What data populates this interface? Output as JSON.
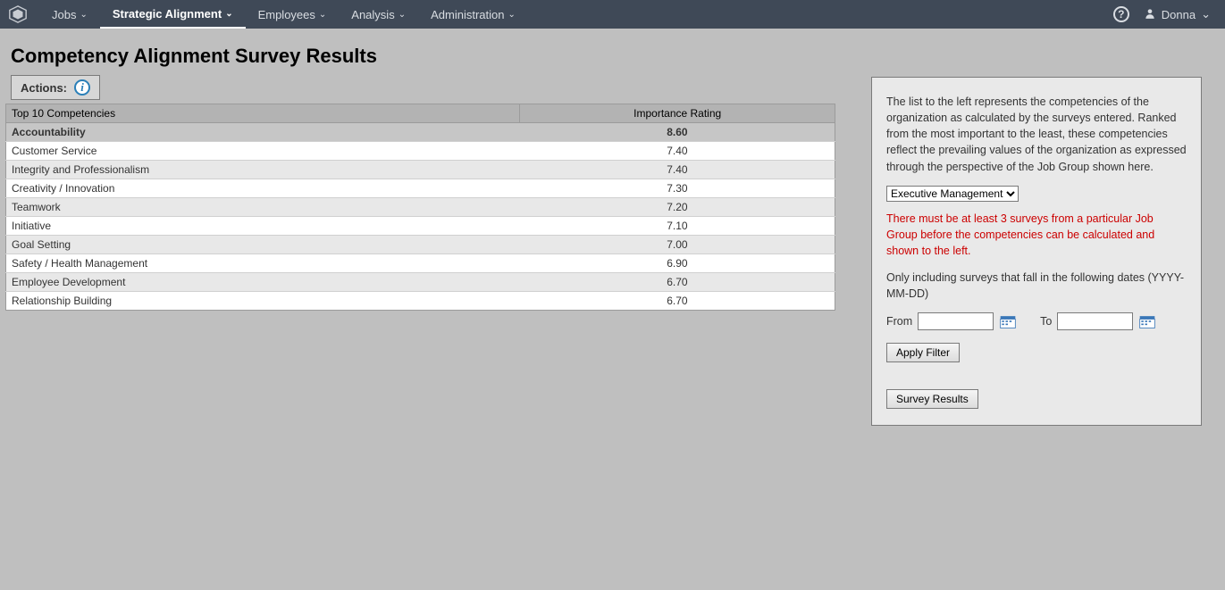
{
  "navbar": {
    "items": [
      {
        "label": "Jobs"
      },
      {
        "label": "Strategic Alignment"
      },
      {
        "label": "Employees"
      },
      {
        "label": "Analysis"
      },
      {
        "label": "Administration"
      }
    ],
    "user": "Donna"
  },
  "page": {
    "title": "Competency Alignment Survey Results",
    "actions_label": "Actions:"
  },
  "table": {
    "col1": "Top 10 Competencies",
    "col2": "Importance Rating",
    "rows": [
      {
        "name": "Accountability",
        "rating": "8.60"
      },
      {
        "name": "Customer Service",
        "rating": "7.40"
      },
      {
        "name": "Integrity and Professionalism",
        "rating": "7.40"
      },
      {
        "name": "Creativity / Innovation",
        "rating": "7.30"
      },
      {
        "name": "Teamwork",
        "rating": "7.20"
      },
      {
        "name": "Initiative",
        "rating": "7.10"
      },
      {
        "name": "Goal Setting",
        "rating": "7.00"
      },
      {
        "name": "Safety / Health Management",
        "rating": "6.90"
      },
      {
        "name": "Employee Development",
        "rating": "6.70"
      },
      {
        "name": "Relationship Building",
        "rating": "6.70"
      }
    ]
  },
  "side": {
    "desc": "The list to the left represents the competencies of the organization as calculated by the surveys entered. Ranked from the most important to the least, these competencies reflect the prevailing values of the organization as expressed through the perspective of the Job Group shown here.",
    "group_selected": "Executive Management",
    "warn": "There must be at least 3 surveys from a particular Job Group before the competencies can be calculated and shown to the left.",
    "date_intro": "Only including surveys that fall in the following dates (YYYY-MM-DD)",
    "from_label": "From",
    "to_label": "To",
    "from_value": "",
    "to_value": "",
    "apply_filter": "Apply Filter",
    "survey_results": "Survey Results"
  }
}
